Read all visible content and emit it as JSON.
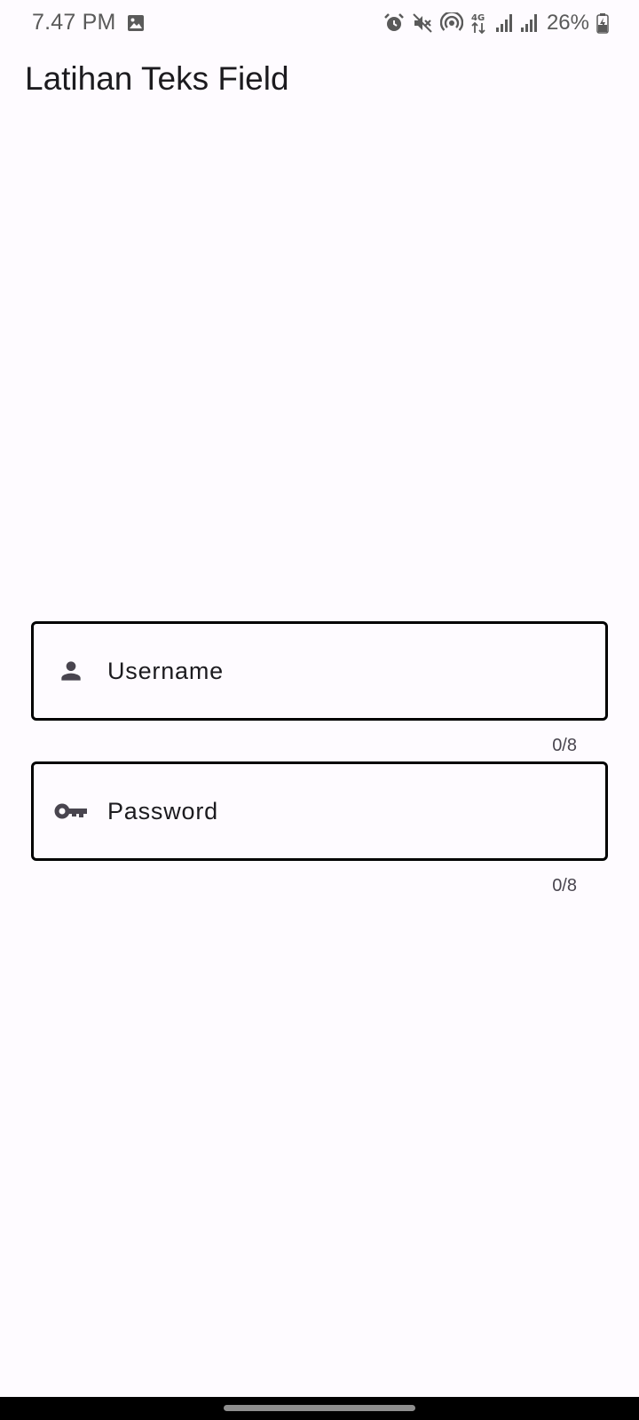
{
  "status_bar": {
    "time": "7.47 PM",
    "battery": "26%",
    "network_label": "4G",
    "icons": [
      "gallery-icon",
      "alarm-icon",
      "mute-icon",
      "hotspot-icon",
      "4g-data-icon",
      "signal-icon",
      "signal-icon",
      "battery-charging-icon"
    ]
  },
  "app_bar": {
    "title": "Latihan Teks Field"
  },
  "form": {
    "username": {
      "placeholder": "Username",
      "icon": "person-icon",
      "counter": "0/8"
    },
    "password": {
      "placeholder": "Password",
      "icon": "key-icon",
      "counter": "0/8"
    }
  },
  "colors": {
    "background": "#fefbff",
    "field_border": "#000000",
    "icon": "#49454f",
    "text": "#1c1b1f"
  }
}
